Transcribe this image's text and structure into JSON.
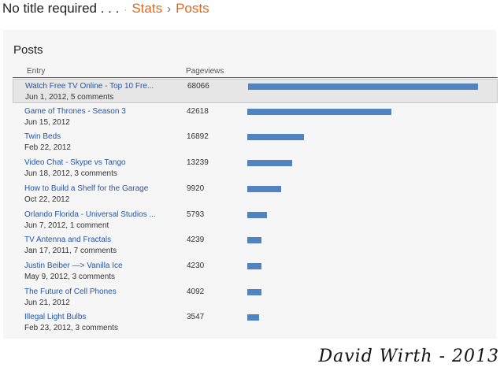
{
  "header": {
    "blog_title": "No title required . . .",
    "separator": "·",
    "crumb_stats": "Stats",
    "crumb_arrow": "›",
    "crumb_posts": "Posts"
  },
  "panel": {
    "title": "Posts",
    "columns": {
      "entry": "Entry",
      "pageviews": "Pageviews"
    }
  },
  "rows": [
    {
      "title": "Watch Free TV Online - Top 10 Fre...",
      "meta": "Jun 1, 2012, 5 comments",
      "pageviews": "68066",
      "value": 68066
    },
    {
      "title": "Game of Thrones - Season 3",
      "meta": "Jun 15, 2012",
      "pageviews": "42618",
      "value": 42618
    },
    {
      "title": "Twin Beds",
      "meta": "Feb 22, 2012",
      "pageviews": "16892",
      "value": 16892
    },
    {
      "title": "Video Chat - Skype vs Tango",
      "meta": "Jun 18, 2012, 3 comments",
      "pageviews": "13239",
      "value": 13239
    },
    {
      "title": "How to Build a Shelf for the Garage",
      "meta": "Oct 22, 2012",
      "pageviews": "9920",
      "value": 9920
    },
    {
      "title": "Orlando Florida - Universal Studios ...",
      "meta": "Jun 7, 2012, 1 comment",
      "pageviews": "5793",
      "value": 5793
    },
    {
      "title": "TV Antenna and Fractals",
      "meta": "Jan 17, 2011, 7 comments",
      "pageviews": "4239",
      "value": 4239
    },
    {
      "title": "Justin Beiber —> Vanilla Ice",
      "meta": "May 9, 2012, 3 comments",
      "pageviews": "4230",
      "value": 4230
    },
    {
      "title": "The Future of Cell Phones",
      "meta": "Jun 21, 2012",
      "pageviews": "4092",
      "value": 4092
    },
    {
      "title": "Illegal Light Bulbs",
      "meta": "Feb 23, 2012, 3 comments",
      "pageviews": "3547",
      "value": 3547
    }
  ],
  "selected_row": 0,
  "colors": {
    "bar": "#4f83c2",
    "link": "#2255aa",
    "crumb": "#dd6a1f"
  },
  "signature": "David Wirth - 2013"
}
